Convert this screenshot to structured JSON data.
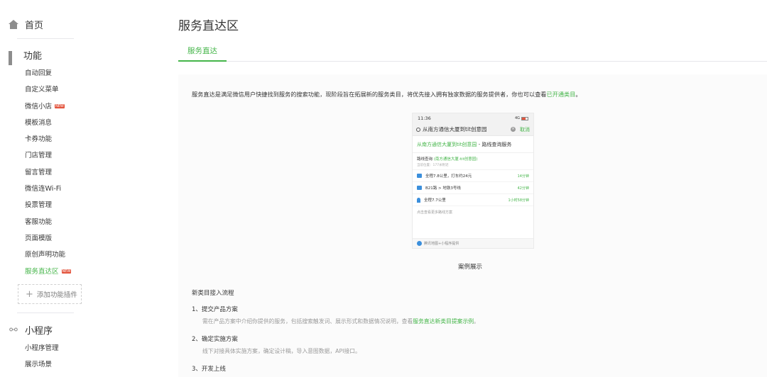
{
  "sidebar": {
    "home_label": "首页",
    "features_label": "功能",
    "feature_items": [
      {
        "label": "自动回复",
        "badge": ""
      },
      {
        "label": "自定义菜单",
        "badge": ""
      },
      {
        "label": "微信小店",
        "badge": "NEW"
      },
      {
        "label": "模板消息",
        "badge": ""
      },
      {
        "label": "卡券功能",
        "badge": ""
      },
      {
        "label": "门店管理",
        "badge": ""
      },
      {
        "label": "留言管理",
        "badge": ""
      },
      {
        "label": "微信连Wi-Fi",
        "badge": ""
      },
      {
        "label": "投票管理",
        "badge": ""
      },
      {
        "label": "客服功能",
        "badge": ""
      },
      {
        "label": "页面模版",
        "badge": ""
      },
      {
        "label": "原创声明功能",
        "badge": ""
      },
      {
        "label": "服务直达区",
        "badge": "NEW"
      }
    ],
    "add_plugin_label": "添加功能插件",
    "miniprogram_label": "小程序",
    "miniprogram_items": [
      "小程序管理",
      "展示场景"
    ],
    "accent_color": "#44b549"
  },
  "main": {
    "page_title": "服务直达区",
    "tab_label": "服务直达",
    "intro_text": "服务直达是满足微信用户快捷找到服务的搜索功能，现阶段旨在拓展新的服务类目，将优先接入拥有独家数据的服务提供者，你也可以查看",
    "intro_link": "已开通类目",
    "intro_end": "。",
    "phone": {
      "time": "11:36",
      "signal": "4G",
      "query": "从南方通信大厦到tit创意园",
      "cancel": "取消",
      "card_title_green": "从南方通信大厦到tit创意园",
      "card_title_rest": " - 路线查询服务",
      "route_label": "路线查询",
      "route_value": "(南方通信大厦-tit创意园)",
      "route_sub": "当前位置：177米附近",
      "rows": [
        {
          "text": "全程7.8公里，打车约24元",
          "time": "14分钟"
        },
        {
          "text": "B21路 > 地铁3号线",
          "time": "42分钟"
        },
        {
          "text": "全程7.7公里",
          "time": "1小时58分钟"
        }
      ],
      "more": "点击查看更多路线方案",
      "footer": "腾讯地图+小程序提供"
    },
    "caption": "案例展示",
    "flow_title": "新类目接入流程",
    "steps": [
      {
        "title": "1、提交产品方案",
        "desc": "需在产品方案中介绍你提供的服务，包括搜索触发词、展示形式和数据情况说明，查看",
        "desc_link": "服务直达新类目提案示例",
        "desc_end": "。"
      },
      {
        "title": "2、确定实施方案",
        "desc": "线下对接具体实施方案，确定设计稿，导入意图数据，API接口。",
        "desc_link": "",
        "desc_end": ""
      },
      {
        "title": "3、开发上线",
        "desc": "",
        "desc_link": "",
        "desc_end": ""
      }
    ]
  }
}
